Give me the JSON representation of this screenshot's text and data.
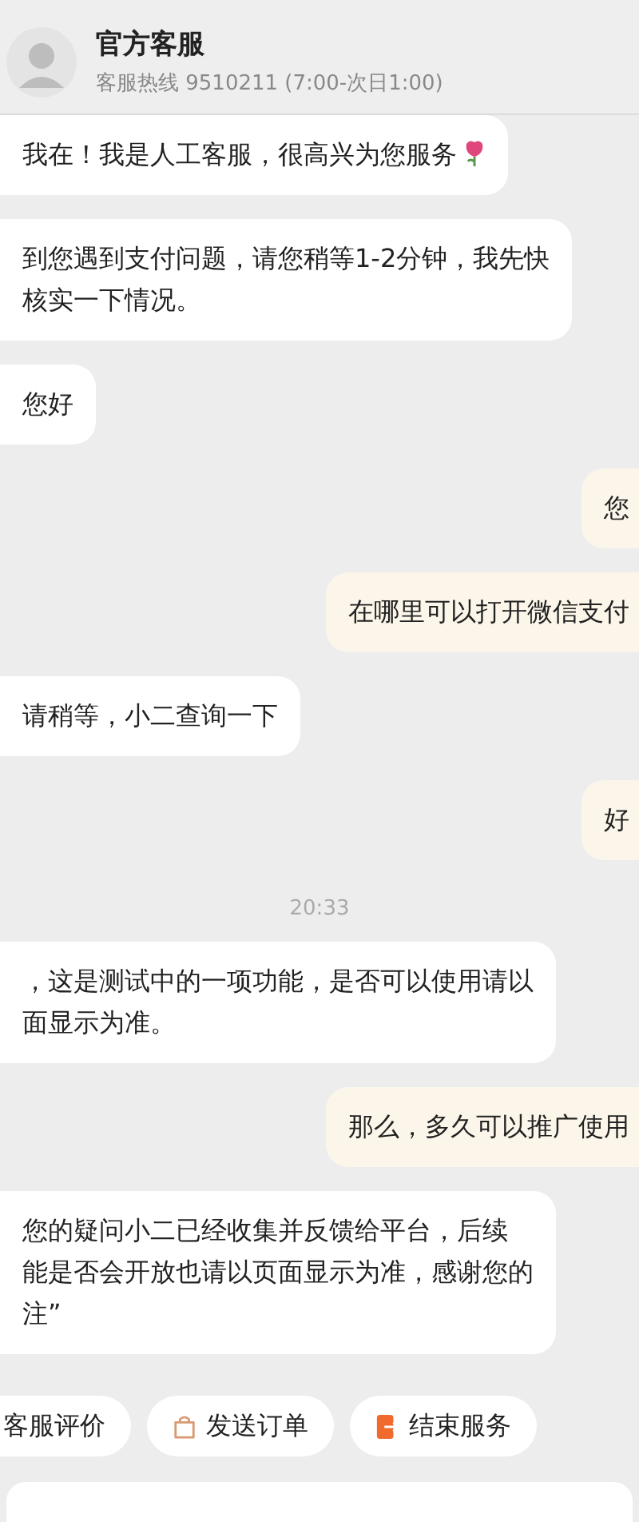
{
  "header": {
    "title": "官方客服",
    "subtitle": "客服热线 9510211 (7:00-次日1:00)"
  },
  "messages": [
    {
      "kind": "greeting",
      "lines": [
        "我在！我是人工客服，很高兴为您服务"
      ]
    },
    {
      "kind": "agent",
      "lines": [
        "到您遇到支付问题，请您稍等1-2分钟，我先快",
        "核实一下情况。"
      ]
    },
    {
      "kind": "agent",
      "lines": [
        "您好"
      ]
    },
    {
      "kind": "user",
      "lines": [
        "您"
      ]
    },
    {
      "kind": "user",
      "lines": [
        "在哪里可以打开微信支付"
      ]
    },
    {
      "kind": "agent",
      "lines": [
        "请稍等，小二查询一下"
      ]
    },
    {
      "kind": "user",
      "lines": [
        "好"
      ]
    },
    {
      "kind": "time",
      "lines": [
        "20:33"
      ]
    },
    {
      "kind": "agent",
      "lines": [
        "，这是测试中的一项功能，是否可以使用请以",
        "面显示为准。"
      ]
    },
    {
      "kind": "user",
      "lines": [
        "那么，多久可以推广使用"
      ]
    },
    {
      "kind": "agent",
      "lines": [
        "您的疑问小二已经收集并反馈给平台，后续",
        "能是否会开放也请以页面显示为准，感谢您的",
        "注”"
      ]
    }
  ],
  "actions": [
    {
      "label": "客服评价",
      "kind": "rating"
    },
    {
      "label": "发送订单",
      "kind": "order"
    },
    {
      "label": "结束服务",
      "kind": "end"
    }
  ]
}
